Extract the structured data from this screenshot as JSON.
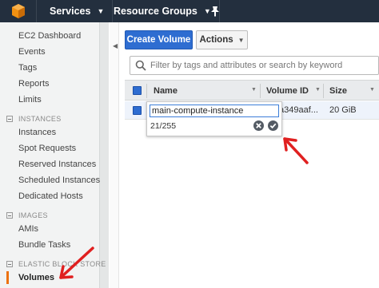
{
  "nav": {
    "services_label": "Services",
    "resource_groups_label": "Resource Groups"
  },
  "sidebar": {
    "links": {
      "ec2_dashboard": "EC2 Dashboard",
      "events": "Events",
      "tags": "Tags",
      "reports": "Reports",
      "limits": "Limits",
      "instances": "Instances",
      "spot_requests": "Spot Requests",
      "reserved_instances": "Reserved Instances",
      "scheduled_instances": "Scheduled Instances",
      "dedicated_hosts": "Dedicated Hosts",
      "amis": "AMIs",
      "bundle_tasks": "Bundle Tasks",
      "volumes": "Volumes"
    },
    "sections": {
      "instances": "INSTANCES",
      "images": "IMAGES",
      "elastic_block_store": "ELASTIC BLOCK STORE"
    }
  },
  "toolbar": {
    "create_volume_label": "Create Volume",
    "actions_label": "Actions"
  },
  "filter": {
    "placeholder": "Filter by tags and attributes or search by keyword"
  },
  "table": {
    "columns": [
      "Name",
      "Volume ID",
      "Size"
    ],
    "rows": [
      {
        "volume_id": "a349aaf...",
        "size": "20 GiB"
      }
    ]
  },
  "edit_popup": {
    "value": "main-compute-instance",
    "char_count": "21/255"
  },
  "colors": {
    "topbar": "#232f3e",
    "primary_button": "#2e6dd1",
    "annotation_arrow": "#e02020",
    "active_indicator": "#ec7211"
  }
}
